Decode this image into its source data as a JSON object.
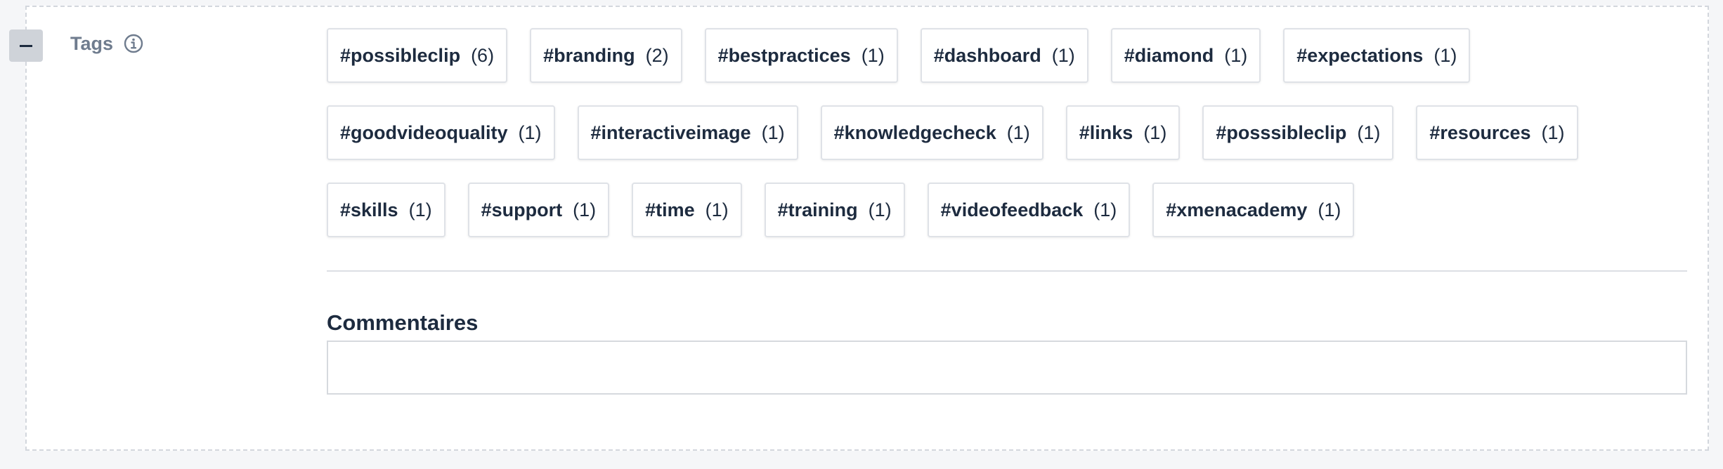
{
  "tags_section": {
    "label": "Tags",
    "info_icon": "info-icon",
    "collapse_icon": "minus-icon"
  },
  "tags": [
    {
      "name": "#possibleclip",
      "count": "(6)"
    },
    {
      "name": "#branding",
      "count": "(2)"
    },
    {
      "name": "#bestpractices",
      "count": "(1)"
    },
    {
      "name": "#dashboard",
      "count": "(1)"
    },
    {
      "name": "#diamond",
      "count": "(1)"
    },
    {
      "name": "#expectations",
      "count": "(1)"
    },
    {
      "name": "#goodvideoquality",
      "count": "(1)"
    },
    {
      "name": "#interactiveimage",
      "count": "(1)"
    },
    {
      "name": "#knowledgecheck",
      "count": "(1)"
    },
    {
      "name": "#links",
      "count": "(1)"
    },
    {
      "name": "#posssibleclip",
      "count": "(1)"
    },
    {
      "name": "#resources",
      "count": "(1)"
    },
    {
      "name": "#skills",
      "count": "(1)"
    },
    {
      "name": "#support",
      "count": "(1)"
    },
    {
      "name": "#time",
      "count": "(1)"
    },
    {
      "name": "#training",
      "count": "(1)"
    },
    {
      "name": "#videofeedback",
      "count": "(1)"
    },
    {
      "name": "#xmenacademy",
      "count": "(1)"
    }
  ],
  "comments": {
    "label": "Commentaires",
    "value": ""
  },
  "colors": {
    "text": "#1d2b3f",
    "muted": "#6f7c8e",
    "border": "#dfe2e7",
    "background": "#f5f6f8"
  }
}
